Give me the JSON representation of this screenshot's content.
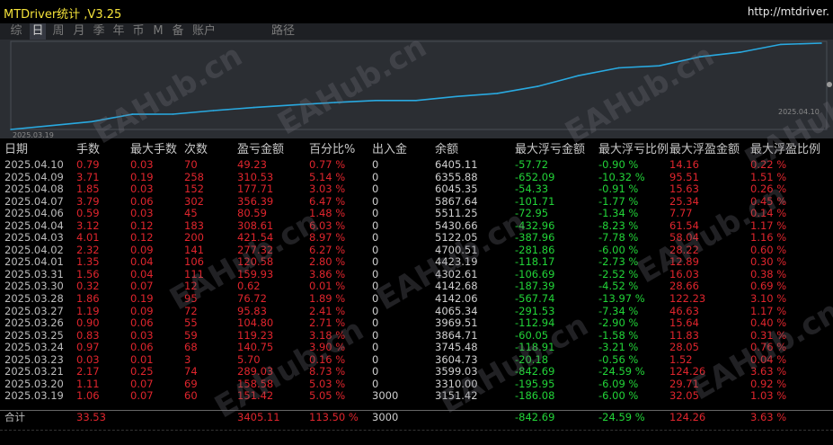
{
  "app": {
    "title": "MTDriver统计 ,V3.25",
    "url": "http://mtdriver."
  },
  "tabs": [
    {
      "label": "综",
      "active": false
    },
    {
      "label": "日",
      "active": true
    },
    {
      "label": "周",
      "active": false
    },
    {
      "label": "月",
      "active": false
    },
    {
      "label": "季",
      "active": false
    },
    {
      "label": "年",
      "active": false
    },
    {
      "label": "币",
      "active": false
    },
    {
      "label": "M",
      "active": false
    },
    {
      "label": "备",
      "active": false
    },
    {
      "label": "账户",
      "active": false
    },
    {
      "label": "路径",
      "active": false
    }
  ],
  "chart_data": {
    "type": "line",
    "x_start_label": "2025.03.19",
    "x_end_label": "2025.04.10",
    "values": [
      3000,
      3151.42,
      3310.0,
      3599.03,
      3604.73,
      3745.48,
      3864.71,
      3969.51,
      4065.34,
      4142.06,
      4142.68,
      4302.61,
      4423.19,
      4700.51,
      5122.05,
      5430.66,
      5511.25,
      5867.64,
      6045.35,
      6355.88,
      6405.11
    ],
    "color": "#29a9e0"
  },
  "columns": [
    "日期",
    "手数",
    "最大手数",
    "次数",
    "盈亏金额",
    "百分比%",
    "出入金",
    "余额",
    "最大浮亏金额",
    "最大浮亏比例",
    "最大浮盈金额",
    "最大浮盈比例"
  ],
  "rows": [
    [
      "2025.04.10",
      "0.79",
      "0.03",
      "70",
      "49.23",
      "0.77 %",
      "0",
      "6405.11",
      "-57.72",
      "-0.90 %",
      "14.16",
      "0.22 %"
    ],
    [
      "2025.04.09",
      "3.71",
      "0.19",
      "258",
      "310.53",
      "5.14 %",
      "0",
      "6355.88",
      "-652.09",
      "-10.32 %",
      "95.51",
      "1.51 %"
    ],
    [
      "2025.04.08",
      "1.85",
      "0.03",
      "152",
      "177.71",
      "3.03 %",
      "0",
      "6045.35",
      "-54.33",
      "-0.91 %",
      "15.63",
      "0.26 %"
    ],
    [
      "2025.04.07",
      "3.79",
      "0.06",
      "302",
      "356.39",
      "6.47 %",
      "0",
      "5867.64",
      "-101.71",
      "-1.77 %",
      "25.34",
      "0.45 %"
    ],
    [
      "2025.04.06",
      "0.59",
      "0.03",
      "45",
      "80.59",
      "1.48 %",
      "0",
      "5511.25",
      "-72.95",
      "-1.34 %",
      "7.77",
      "0.14 %"
    ],
    [
      "2025.04.04",
      "3.12",
      "0.12",
      "183",
      "308.61",
      "6.03 %",
      "0",
      "5430.66",
      "-432.96",
      "-8.23 %",
      "61.54",
      "1.17 %"
    ],
    [
      "2025.04.03",
      "4.01",
      "0.12",
      "200",
      "421.54",
      "8.97 %",
      "0",
      "5122.05",
      "-387.96",
      "-7.78 %",
      "58.04",
      "1.16 %"
    ],
    [
      "2025.04.02",
      "2.32",
      "0.09",
      "141",
      "277.32",
      "6.27 %",
      "0",
      "4700.51",
      "-281.86",
      "-6.00 %",
      "28.22",
      "0.60 %"
    ],
    [
      "2025.04.01",
      "1.35",
      "0.04",
      "106",
      "120.58",
      "2.80 %",
      "0",
      "4423.19",
      "-118.17",
      "-2.73 %",
      "12.89",
      "0.30 %"
    ],
    [
      "2025.03.31",
      "1.56",
      "0.04",
      "111",
      "159.93",
      "3.86 %",
      "0",
      "4302.61",
      "-106.69",
      "-2.52 %",
      "16.03",
      "0.38 %"
    ],
    [
      "2025.03.30",
      "0.32",
      "0.07",
      "12",
      "0.62",
      "0.01 %",
      "0",
      "4142.68",
      "-187.39",
      "-4.52 %",
      "28.66",
      "0.69 %"
    ],
    [
      "2025.03.28",
      "1.86",
      "0.19",
      "95",
      "76.72",
      "1.89 %",
      "0",
      "4142.06",
      "-567.74",
      "-13.97 %",
      "122.23",
      "3.10 %"
    ],
    [
      "2025.03.27",
      "1.19",
      "0.09",
      "72",
      "95.83",
      "2.41 %",
      "0",
      "4065.34",
      "-291.53",
      "-7.34 %",
      "46.63",
      "1.17 %"
    ],
    [
      "2025.03.26",
      "0.90",
      "0.06",
      "55",
      "104.80",
      "2.71 %",
      "0",
      "3969.51",
      "-112.94",
      "-2.90 %",
      "15.64",
      "0.40 %"
    ],
    [
      "2025.03.25",
      "0.83",
      "0.03",
      "59",
      "119.23",
      "3.18 %",
      "0",
      "3864.71",
      "-60.05",
      "-1.58 %",
      "11.83",
      "0.31 %"
    ],
    [
      "2025.03.24",
      "0.97",
      "0.06",
      "68",
      "140.75",
      "3.90 %",
      "0",
      "3745.48",
      "-118.91",
      "-3.21 %",
      "28.05",
      "0.76 %"
    ],
    [
      "2025.03.23",
      "0.03",
      "0.01",
      "3",
      "5.70",
      "0.16 %",
      "0",
      "3604.73",
      "-20.18",
      "-0.56 %",
      "1.52",
      "0.04 %"
    ],
    [
      "2025.03.21",
      "2.17",
      "0.25",
      "74",
      "289.03",
      "8.73 %",
      "0",
      "3599.03",
      "-842.69",
      "-24.59 %",
      "124.26",
      "3.63 %"
    ],
    [
      "2025.03.20",
      "1.11",
      "0.07",
      "69",
      "158.58",
      "5.03 %",
      "0",
      "3310.00",
      "-195.95",
      "-6.09 %",
      "29.71",
      "0.92 %"
    ],
    [
      "2025.03.19",
      "1.06",
      "0.07",
      "60",
      "151.42",
      "5.05 %",
      "3000",
      "3151.42",
      "-186.08",
      "-6.00 %",
      "32.05",
      "1.03 %"
    ]
  ],
  "total": [
    "合计",
    "33.53",
    "",
    "",
    "3405.11",
    "113.50 %",
    "3000",
    "",
    "-842.69",
    "-24.59 %",
    "124.26",
    "3.63 %"
  ],
  "watermark": "EAHub.cn",
  "colors": {
    "positive": "#e0252d",
    "negative": "#22d438",
    "line": "#29a9e0",
    "title": "#f4e23a"
  }
}
